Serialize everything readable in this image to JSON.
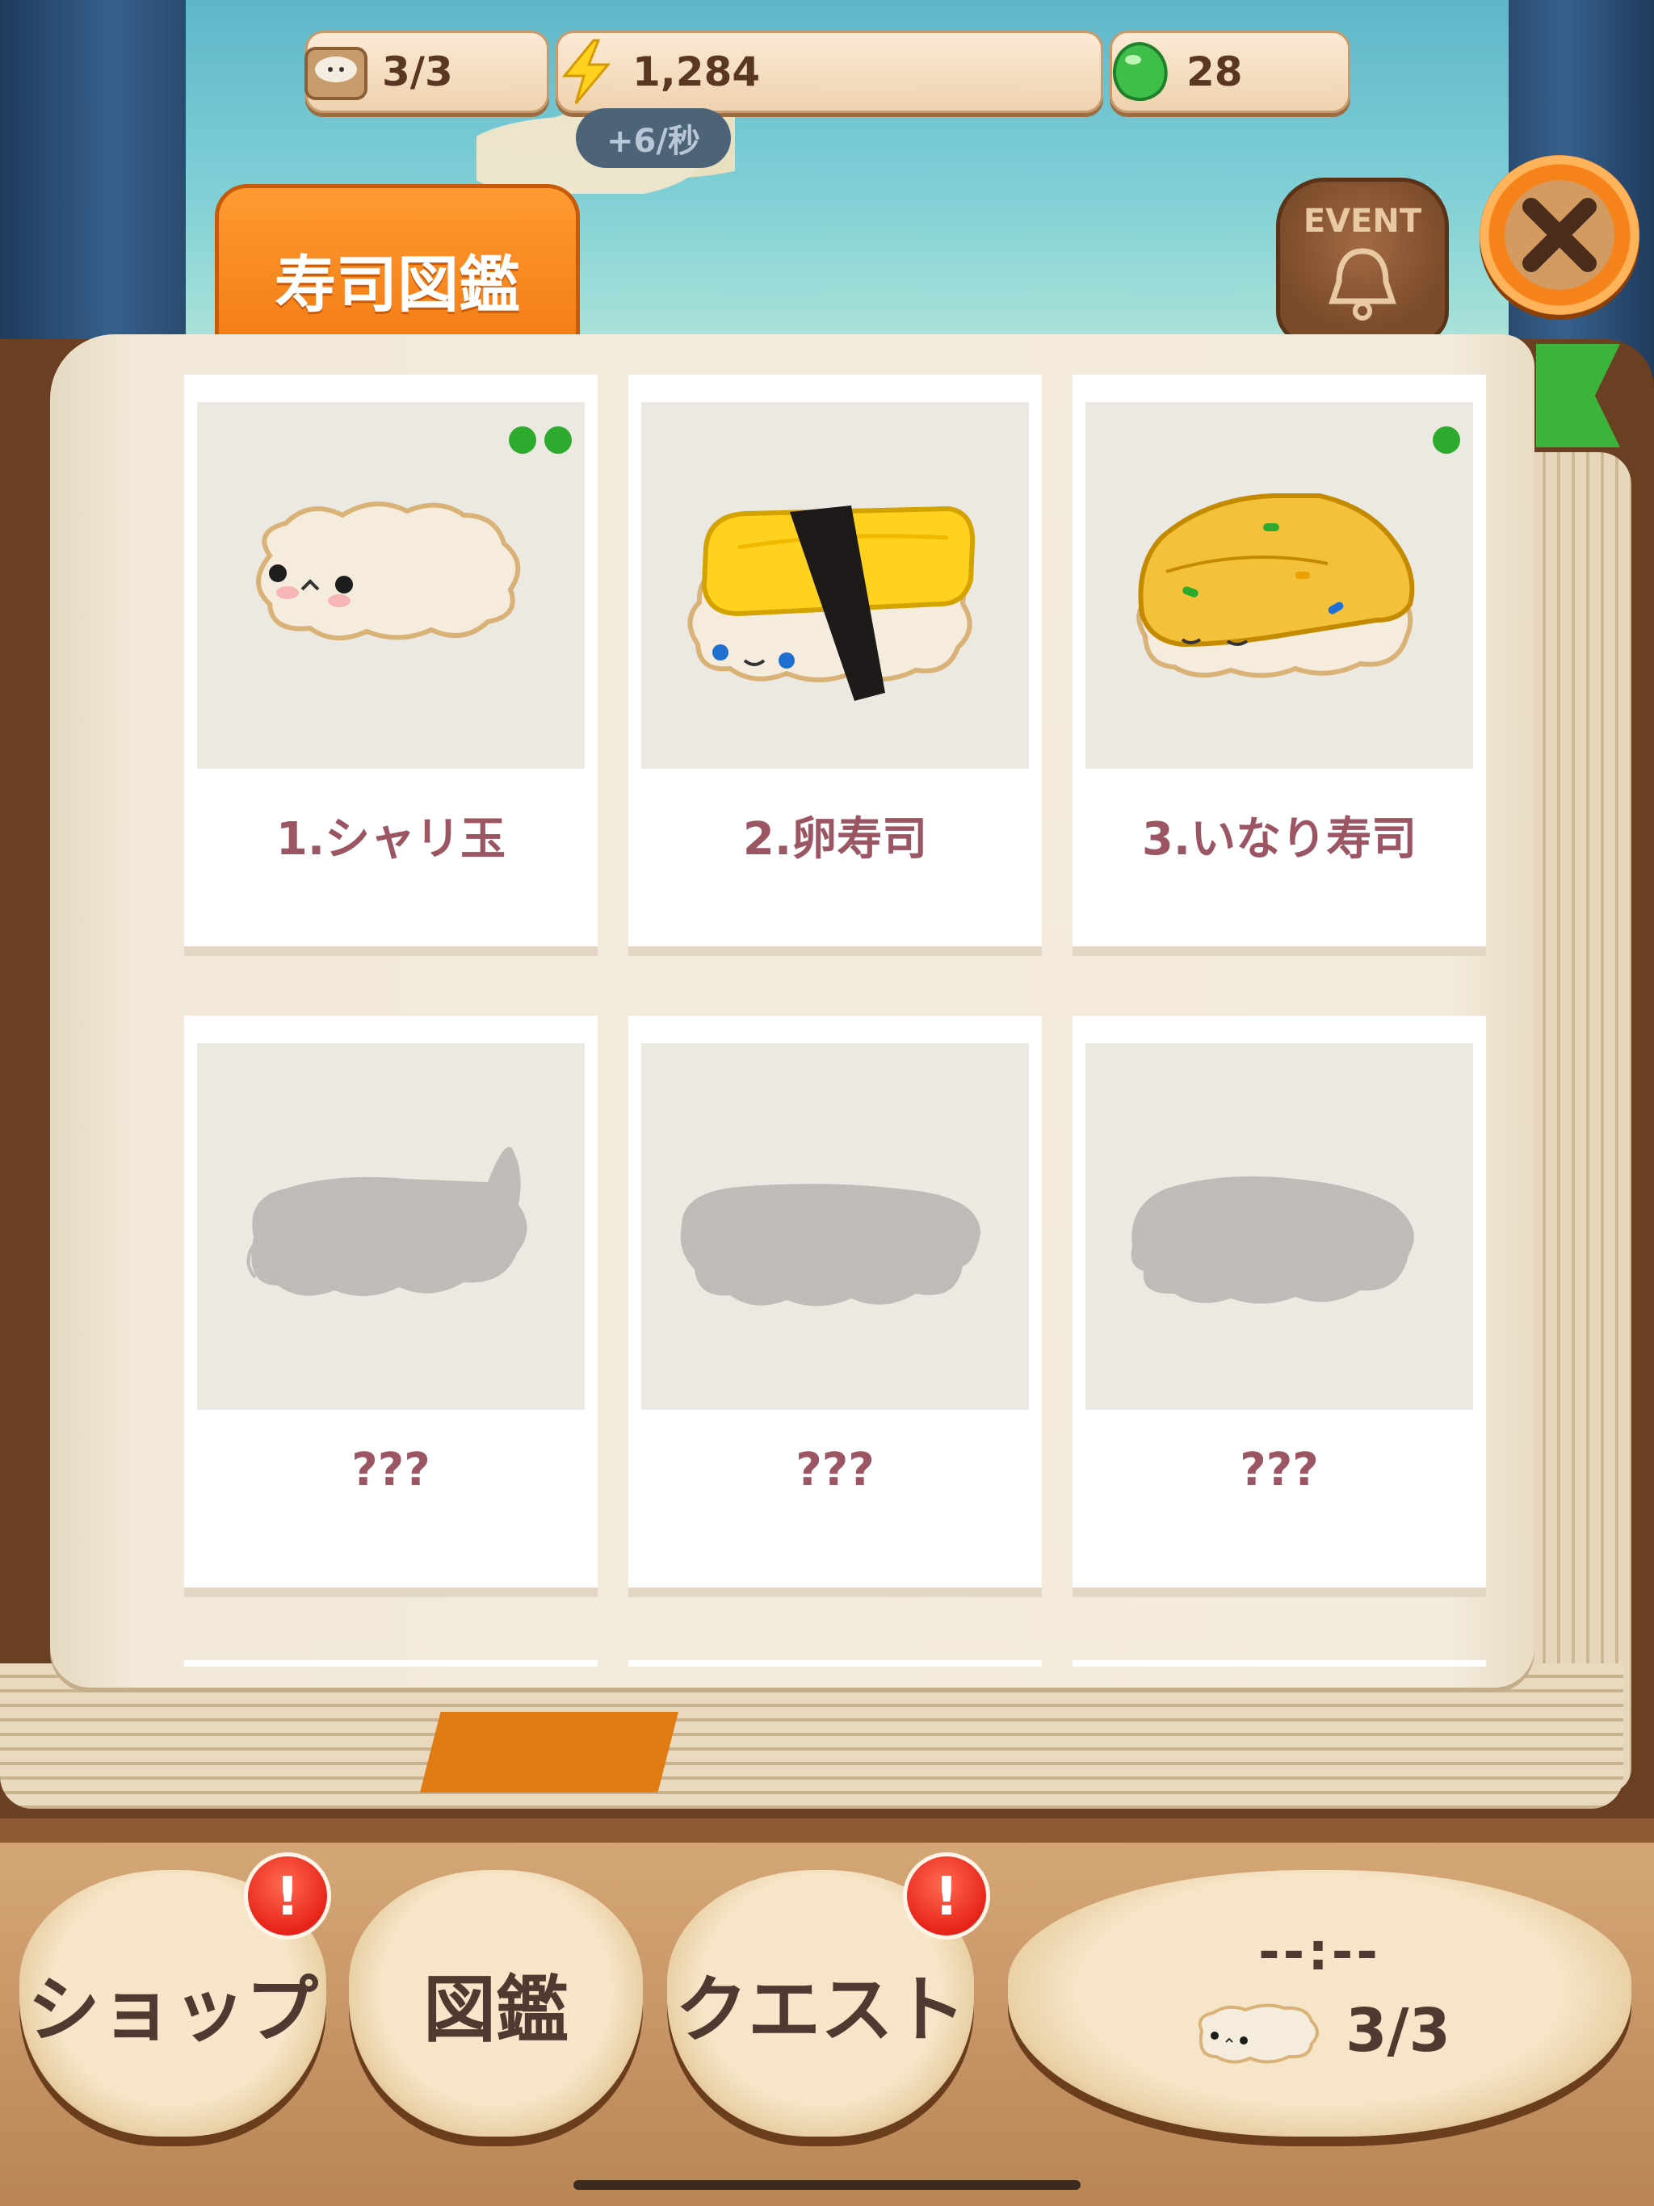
{
  "resources": {
    "capacity": "3/3",
    "energy": "1,284",
    "gems": "28",
    "rate": "+6/秒"
  },
  "header": {
    "tab_title": "寿司図鑑",
    "event_label": "EVENT"
  },
  "cards": [
    {
      "name": "1.シャリ玉",
      "dots": 2,
      "unlocked": true,
      "image": "shari-rice-ball"
    },
    {
      "name": "2.卵寿司",
      "dots": 0,
      "unlocked": true,
      "image": "tamago-sushi"
    },
    {
      "name": "3.いなり寿司",
      "dots": 1,
      "unlocked": true,
      "image": "inari-sushi"
    },
    {
      "name": "???",
      "dots": 0,
      "unlocked": false,
      "image": "shrimp-silhouette"
    },
    {
      "name": "???",
      "dots": 0,
      "unlocked": false,
      "image": "sushi-silhouette"
    },
    {
      "name": "???",
      "dots": 0,
      "unlocked": false,
      "image": "sushi-silhouette-2"
    }
  ],
  "nav": {
    "shop": "ショップ",
    "book": "図鑑",
    "quest": "クエスト",
    "timer": "--:--",
    "count": "3/3",
    "shop_alert": "!",
    "quest_alert": "!"
  },
  "colors": {
    "accent": "#f37c14",
    "card_title": "#9b5563",
    "badge": "#2eaa2e"
  }
}
